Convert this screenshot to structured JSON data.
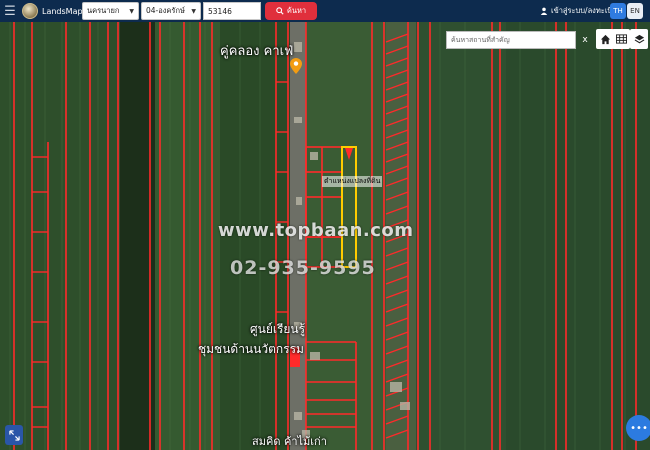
{
  "header": {
    "brand": "LandsMaps",
    "province_select": "นครนายก",
    "district_select": "04-องครักษ์",
    "parcel_number": "53146",
    "search_label": "ค้นหา",
    "login_label": "เข้าสู่ระบบ/ลงทะเบียน",
    "lang_th": "TH",
    "lang_en": "EN",
    "active_lang": "TH"
  },
  "map": {
    "place_search_placeholder": "ค้นหาสถานที่สำคัญ",
    "clear_label": "x",
    "labels": {
      "khlong": "คู่คลอง คาเฟ่",
      "parcel": "ตำแหน่งแปลงที่ดิน",
      "center_line1": "ศูนย์เรียนรู้",
      "center_line2": "ชุมชนด้านนวัตกรรม",
      "shop": "สมคิด ค้าไม้เก่า"
    },
    "watermark_url": "www.topbaan.com",
    "watermark_phone": "02-935-9595"
  },
  "colors": {
    "topbar": "#0d2b4e",
    "search_button": "#e02f3c",
    "parcel_line": "#ff2a2a",
    "selected_parcel": "#ffcc00",
    "lang_active": "#2f7be0",
    "chat_button": "#2c7be0"
  },
  "icons": {
    "menu": "hamburger-icon",
    "search": "search-icon",
    "user": "user-icon",
    "home": "home-icon",
    "grid": "grid-icon",
    "layers": "layers-icon",
    "expand": "expand-icon",
    "chat": "chat-icon",
    "pin": "location-pin-icon"
  }
}
